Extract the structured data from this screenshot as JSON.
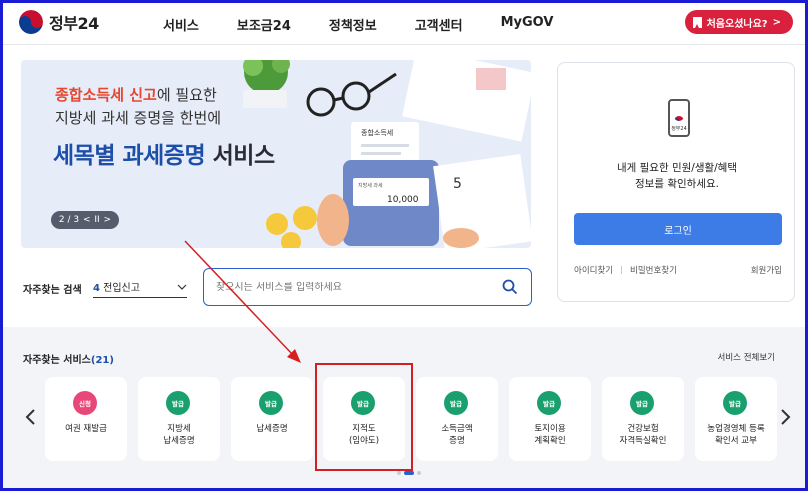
{
  "header": {
    "logo_text": "정부24",
    "nav": [
      {
        "label": "서비스"
      },
      {
        "label": "보조금24"
      },
      {
        "label": "정책정보"
      },
      {
        "label": "고객센터"
      },
      {
        "label": "MyGOV"
      }
    ],
    "first_visit_label": "처음오셨나요?",
    "first_visit_arrow": ">"
  },
  "banner": {
    "line1_highlight": "종합소득세 신고",
    "line1_rest": "에 필요한",
    "line2": "지방세 과세 증명을 한번에",
    "line3_blue": "세목별 과세증명",
    "line3_dark": " 서비스",
    "pager_text": "2 / 3",
    "pager_prev": "<",
    "pager_pause": "II",
    "pager_next": ">",
    "card_title": "종합소득세",
    "calc_label": "지방세 과세",
    "calc_value": "10,000",
    "calendar_day": "5",
    "accent_color": "#e8462f",
    "title_color": "#1d4fa8"
  },
  "search": {
    "label": "자주찾는 검색",
    "select_number": "4",
    "select_value": "전입신고",
    "placeholder": "찾으시는 서비스를 입력하세요",
    "icon": "search-icon"
  },
  "login": {
    "app_label": "정부24",
    "desc_line1": "내게 필요한 민원/생활/혜택",
    "desc_line2": "정보를 확인하세요.",
    "button_label": "로그인",
    "find_id": "아이디찾기",
    "find_pw": "비밀번호찾기",
    "signup": "회원가입"
  },
  "favorites": {
    "title": "자주찾는 서비스",
    "count": "(21)",
    "view_all": "서비스 전체보기",
    "cards": [
      {
        "badge": "신청",
        "line1": "여권 재발급",
        "line2": "",
        "badge_color": "#e8477a"
      },
      {
        "badge": "발급",
        "line1": "지방세",
        "line2": "납세증명",
        "badge_color": "#1a9f6e"
      },
      {
        "badge": "발급",
        "line1": "납세증명",
        "line2": "",
        "badge_color": "#1a9f6e"
      },
      {
        "badge": "발급",
        "line1": "지적도",
        "line2": "(임야도)",
        "badge_color": "#1a9f6e"
      },
      {
        "badge": "발급",
        "line1": "소득금액",
        "line2": "증명",
        "badge_color": "#1a9f6e"
      },
      {
        "badge": "발급",
        "line1": "토지이용",
        "line2": "계획확인",
        "badge_color": "#1a9f6e"
      },
      {
        "badge": "발급",
        "line1": "건강보험",
        "line2": "자격득실확인",
        "badge_color": "#1a9f6e"
      },
      {
        "badge": "발급",
        "line1": "농업경영체 등록",
        "line2": "확인서 교부",
        "badge_color": "#1a9f6e"
      }
    ]
  },
  "annotation": {
    "color": "#d42020"
  }
}
